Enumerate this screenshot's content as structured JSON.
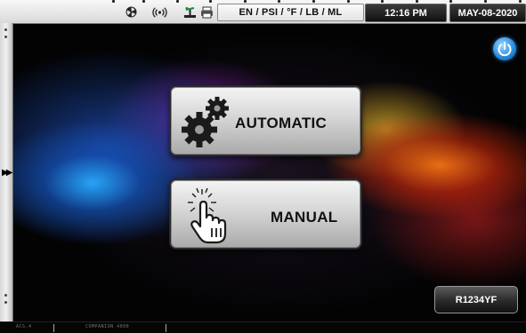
{
  "status_bar": {
    "icons": [
      "fan-icon",
      "wireless-icon",
      "scale-icon",
      "printer-icon"
    ],
    "units": "EN / PSI / °F / LB / ML",
    "time": "12:16 PM",
    "date": "MAY-08-2020"
  },
  "main": {
    "automatic_label": "AUTOMATIC",
    "manual_label": "MANUAL",
    "automatic_icon": "gears-icon",
    "manual_icon": "touch-hand-icon"
  },
  "side_panel": {
    "expand_icon": "double-chevron-right-icon"
  },
  "power_icon": "power-icon",
  "refrigerant_label": "R1234YF",
  "bottom_bar": {
    "left_text": "ACS.4",
    "middle_text": "COMPANION 4000"
  },
  "colors": {
    "accent_blue": "#2b8fe0",
    "button_gray": "#d6d6d6",
    "status_dark": "#111111"
  }
}
